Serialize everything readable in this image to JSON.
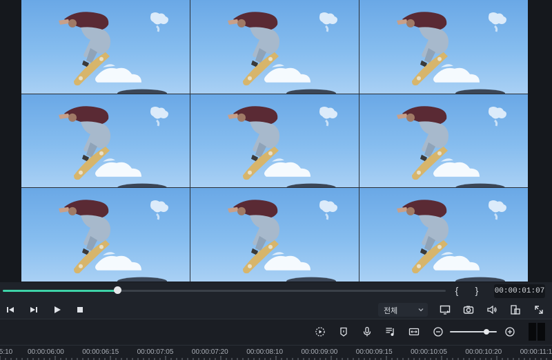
{
  "preview": {
    "grid_tiles": 9
  },
  "scrubber": {
    "progress": 0.258,
    "in_marker": "{",
    "out_marker": "}",
    "timecode": "00:00:01:07"
  },
  "playback": {
    "icons": [
      "step-back-icon",
      "step-forward-icon",
      "play-icon",
      "stop-icon"
    ],
    "view_select": "전체",
    "right_icons": [
      "display-icon",
      "snapshot-icon",
      "volume-icon",
      "fit-screen-icon",
      "fullscreen-icon"
    ]
  },
  "timeline_toolbar": {
    "icons": [
      "render-icon",
      "marker-icon",
      "microphone-icon",
      "audio-mixer-icon",
      "fit-timeline-icon",
      "zoom-out-icon",
      "zoom-in-icon"
    ],
    "zoom_level": 0.78
  },
  "ruler": {
    "labels": [
      ":5:10",
      "00:00:06:00",
      "00:00:06:15",
      "00:00:07:05",
      "00:00:07:20",
      "00:00:08:10",
      "00:00:09:00",
      "00:00:09:15",
      "00:00:10:05",
      "00:00:10:20",
      "00:00:11:1"
    ]
  },
  "colors": {
    "accent": "#3ed3a8",
    "background": "#1b1e24",
    "sky": "#86bdef"
  }
}
